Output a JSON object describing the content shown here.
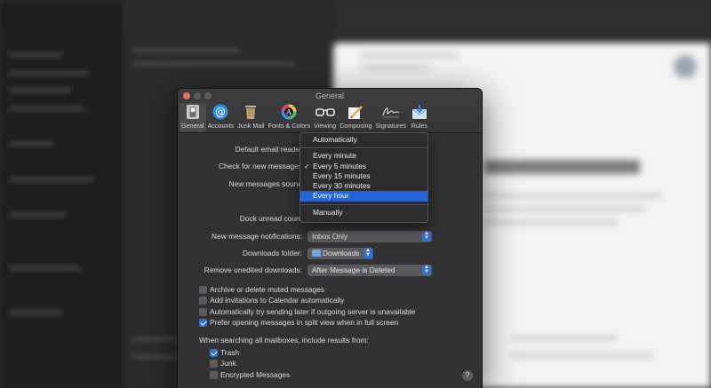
{
  "window": {
    "title": "General"
  },
  "toolbar": [
    {
      "label": "General",
      "icon": "general-switch-icon"
    },
    {
      "label": "Accounts",
      "icon": "at-sign-icon"
    },
    {
      "label": "Junk Mail",
      "icon": "trash-can-icon"
    },
    {
      "label": "Fonts & Colors",
      "icon": "color-wheel-icon"
    },
    {
      "label": "Viewing",
      "icon": "glasses-icon"
    },
    {
      "label": "Composing",
      "icon": "pencil-paper-icon"
    },
    {
      "label": "Signatures",
      "icon": "signature-icon"
    },
    {
      "label": "Rules",
      "icon": "mail-rules-icon"
    }
  ],
  "fields": {
    "default_reader_label": "Default email reader",
    "check_label": "Check for new messages",
    "sound_label": "New messages sound",
    "dock_label": "Dock unread count",
    "notif_label": "New message notifications:",
    "notif_value": "Inbox Only",
    "downloads_label": "Downloads folder:",
    "downloads_value": "Downloads",
    "remove_label": "Remove unedited downloads:",
    "remove_value": "After Message is Deleted"
  },
  "checkboxes": [
    {
      "label": "Archive or delete muted messages",
      "checked": false
    },
    {
      "label": "Add invitations to Calendar automatically",
      "checked": false
    },
    {
      "label": "Automatically try sending later if outgoing server is unavailable",
      "checked": false
    },
    {
      "label": "Prefer opening messages in split view when in full screen",
      "checked": true
    }
  ],
  "search": {
    "label": "When searching all mailboxes, include results from:",
    "options": [
      {
        "label": "Trash",
        "checked": true
      },
      {
        "label": "Junk",
        "checked": false
      },
      {
        "label": "Encrypted Messages",
        "checked": false
      }
    ]
  },
  "help_label": "?",
  "menu": {
    "items": [
      "Automatically",
      "Every minute",
      "Every 5 minutes",
      "Every 15 minutes",
      "Every 30 minutes",
      "Every hour",
      "Manually"
    ],
    "checked": "Every 5 minutes",
    "highlighted": "Every hour",
    "check_mark": "✓"
  },
  "colors": {
    "accent": "#2563d6",
    "window_bg": "#323234",
    "close_button": "#ed6a5e"
  }
}
